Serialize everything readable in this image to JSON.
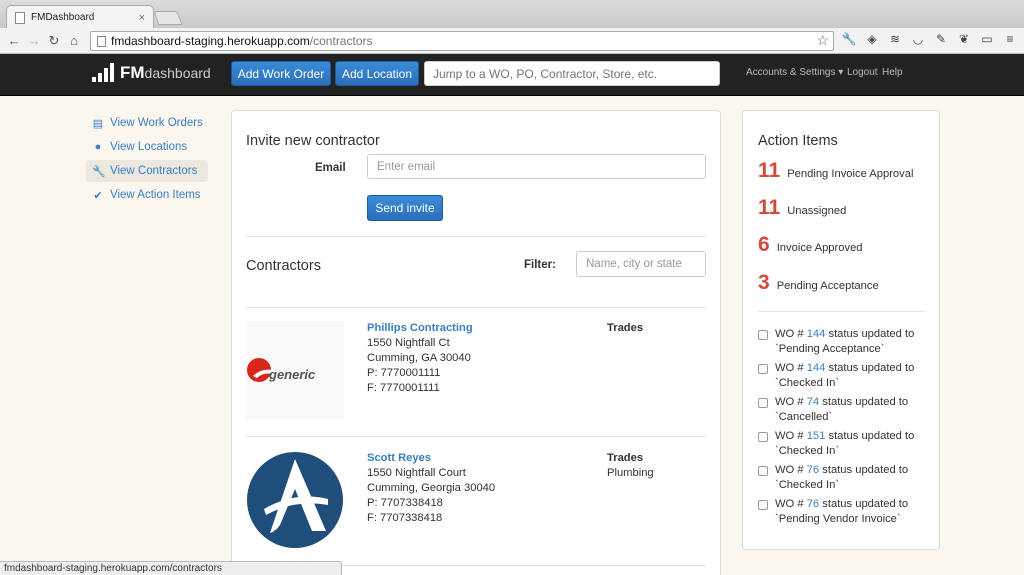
{
  "browser": {
    "tab_title": "FMDashboard",
    "url_domain": "fmdashboard-staging.herokuapp.com",
    "url_path": "/contractors",
    "status_url": "fmdashboard-staging.herokuapp.com/contractors"
  },
  "appnav": {
    "logo_fm": "FM",
    "logo_dash": "dashboard",
    "add_work_order": "Add Work Order",
    "add_location": "Add Location",
    "jump_placeholder": "Jump to a WO, PO, Contractor, Store, etc.",
    "accounts": "Accounts & Settings ▾",
    "logout": "Logout",
    "help": "Help"
  },
  "sidebar": {
    "items": [
      {
        "label": "View Work Orders",
        "icon": "list-icon"
      },
      {
        "label": "View Locations",
        "icon": "map-marker-icon"
      },
      {
        "label": "View Contractors",
        "icon": "wrench-icon"
      },
      {
        "label": "View Action Items",
        "icon": "check-icon"
      }
    ]
  },
  "invite": {
    "title": "Invite new contractor",
    "email_label": "Email",
    "email_placeholder": "Enter email",
    "send_label": "Send invite"
  },
  "contractors": {
    "title": "Contractors",
    "filter_label": "Filter:",
    "filter_placeholder": "Name, city or state",
    "list": [
      {
        "name": "Phillips Contracting",
        "address1": "1550 Nightfall Ct",
        "address2": "Cumming, GA 30040",
        "phone": "P: 7770001111",
        "fax": "F: 7770001111",
        "trades_label": "Trades",
        "trades": "",
        "logo_text": "generic"
      },
      {
        "name": "Scott Reyes",
        "address1": "1550 Nightfall Court",
        "address2": "Cumming, Georgia 30040",
        "phone": "P: 7707338418",
        "fax": "F: 7707338418",
        "trades_label": "Trades",
        "trades": "Plumbing",
        "logo_text": ""
      }
    ]
  },
  "action_items": {
    "title": "Action Items",
    "counts": [
      {
        "count": "11",
        "label": "Pending Invoice Approval"
      },
      {
        "count": "11",
        "label": "Unassigned"
      },
      {
        "count": "6",
        "label": "Invoice Approved"
      },
      {
        "count": "3",
        "label": "Pending Acceptance"
      }
    ],
    "updates": [
      {
        "prefix": "WO #",
        "wo": "144",
        "suffix": "status updated to",
        "status": "`Pending Acceptance`"
      },
      {
        "prefix": "WO #",
        "wo": "144",
        "suffix": "status updated to",
        "status": "`Checked In`"
      },
      {
        "prefix": "WO #",
        "wo": "74",
        "suffix": "status updated to",
        "status": "`Cancelled`"
      },
      {
        "prefix": "WO #",
        "wo": "151",
        "suffix": "status updated to",
        "status": "`Checked In`"
      },
      {
        "prefix": "WO #",
        "wo": "76",
        "suffix": "status updated to",
        "status": "`Checked In`"
      },
      {
        "prefix": "WO #",
        "wo": "76",
        "suffix": "status updated to",
        "status": "`Pending Vendor Invoice`"
      }
    ]
  },
  "colors": {
    "accent": "#3a7fc1",
    "count_red": "#d24a3a",
    "nav_bg": "#222222",
    "page_bg": "#faf7ee"
  }
}
